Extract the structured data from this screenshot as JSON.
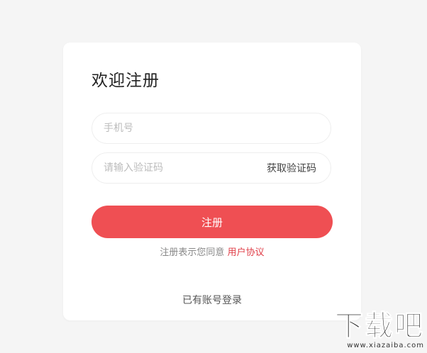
{
  "title": "欢迎注册",
  "phone": {
    "value": "",
    "placeholder": "手机号"
  },
  "code": {
    "value": "",
    "placeholder": "请输入验证码",
    "get_code_label": "获取验证码"
  },
  "register_label": "注册",
  "agreement": {
    "prefix": "注册表示您同意",
    "link": "用户协议"
  },
  "login_link": "已有账号登录",
  "watermark": {
    "logo": "下载吧",
    "url": "www.xiazaiba.com"
  },
  "colors": {
    "accent": "#ef4f53",
    "link": "#e0404a",
    "background": "#f5f5f5",
    "card": "#ffffff"
  }
}
